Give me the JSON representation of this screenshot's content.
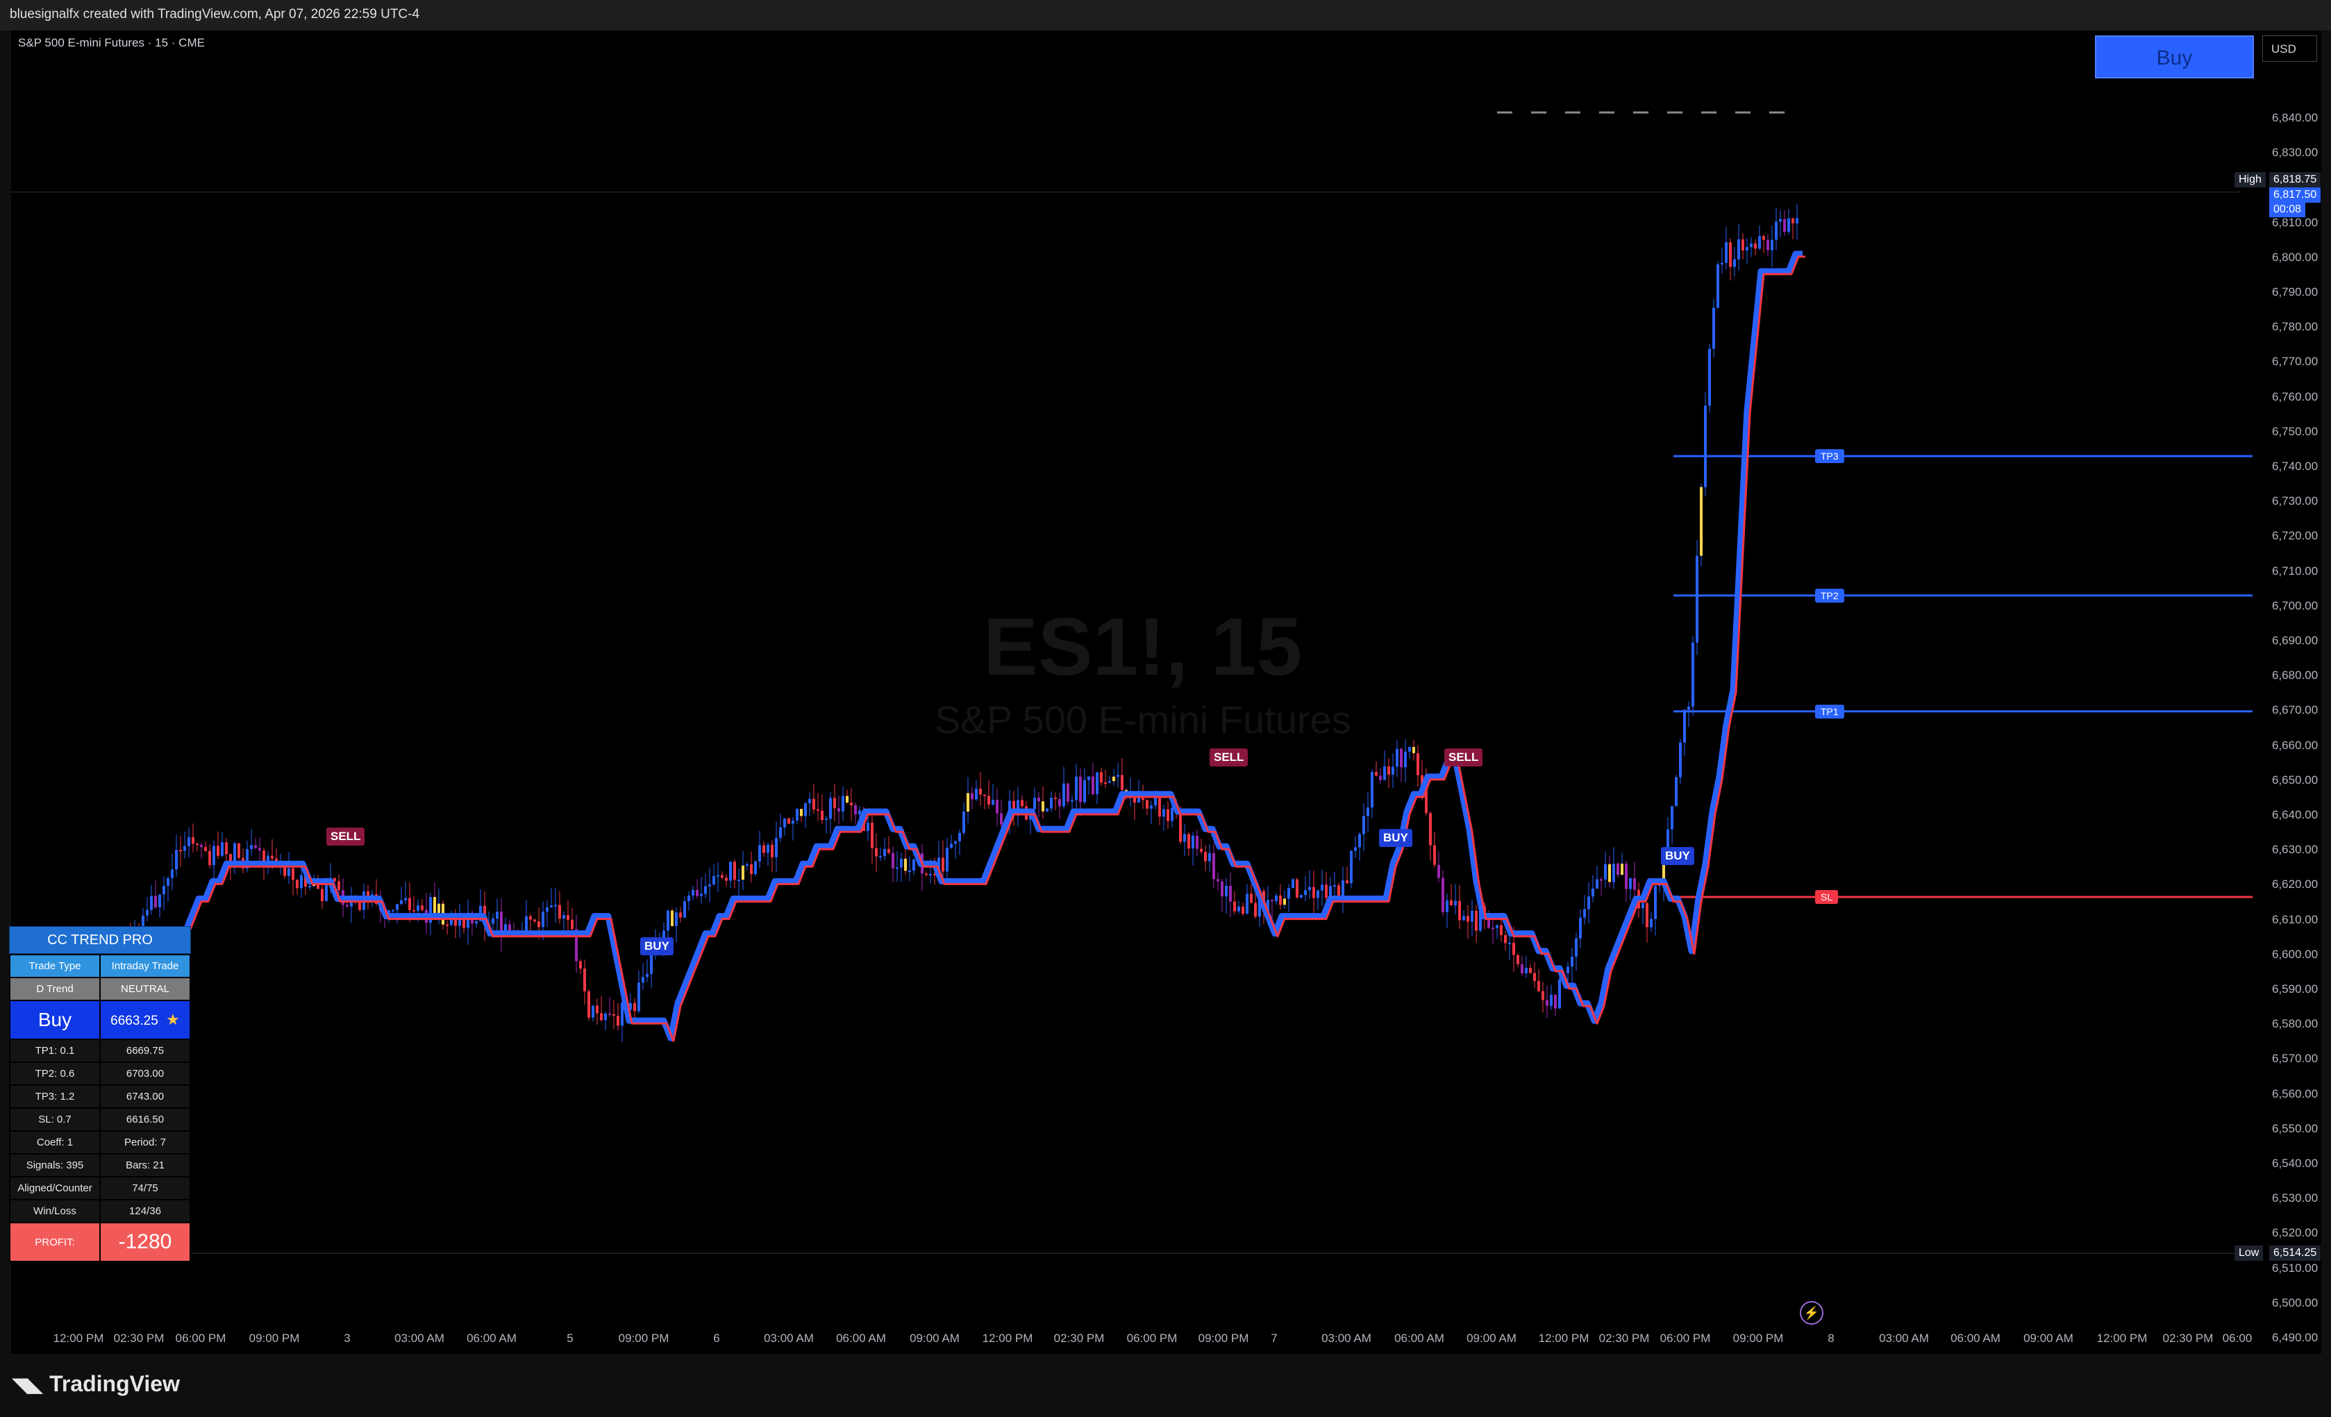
{
  "header": {
    "text": "bluesignalfx created with TradingView.com, Apr 07, 2026 22:59 UTC-4"
  },
  "symbol": {
    "title": "S&P 500 E-mini Futures · 15 · CME",
    "watermark_ticker": "ES1!, 15",
    "watermark_name": "S&P 500 E-mini Futures"
  },
  "trade": {
    "buy_label": "Buy",
    "currency": "USD"
  },
  "price_axis": {
    "ticks": [
      "6,840.00",
      "6,830.00",
      "6,810.00",
      "6,800.00",
      "6,790.00",
      "6,780.00",
      "6,770.00",
      "6,760.00",
      "6,750.00",
      "6,740.00",
      "6,730.00",
      "6,720.00",
      "6,710.00",
      "6,700.00",
      "6,690.00",
      "6,680.00",
      "6,670.00",
      "6,660.00",
      "6,650.00",
      "6,640.00",
      "6,630.00",
      "6,620.00",
      "6,610.00",
      "6,600.00",
      "6,590.00",
      "6,580.00",
      "6,570.00",
      "6,560.00",
      "6,550.00",
      "6,540.00",
      "6,530.00",
      "6,520.00",
      "6,510.00",
      "6,500.00",
      "6,490.00"
    ],
    "high_label": "High",
    "high_value": "6,818.75",
    "last_price": "6,817.50",
    "countdown": "00:08",
    "low_label": "Low",
    "low_value": "6,514.25",
    "colors": {
      "up": "#2962ff",
      "down": "#f23645",
      "accent": "#2962ff"
    }
  },
  "time_axis": {
    "labels": [
      "12:00 PM",
      "02:30 PM",
      "06:00 PM",
      "09:00 PM",
      "3",
      "03:00 AM",
      "06:00 AM",
      "5",
      "09:00 PM",
      "6",
      "03:00 AM",
      "06:00 AM",
      "09:00 AM",
      "12:00 PM",
      "02:30 PM",
      "06:00 PM",
      "09:00 PM",
      "7",
      "03:00 AM",
      "06:00 AM",
      "09:00 AM",
      "12:00 PM",
      "02:30 PM",
      "06:00 PM",
      "09:00 PM",
      "8",
      "03:00 AM",
      "06:00 AM",
      "09:00 AM",
      "12:00 PM",
      "02:30 PM",
      "06:00"
    ]
  },
  "signals": [
    {
      "label": "SELL",
      "type": "sell"
    },
    {
      "label": "BUY",
      "type": "buy"
    },
    {
      "label": "SELL",
      "type": "sell"
    },
    {
      "label": "BUY",
      "type": "buy"
    },
    {
      "label": "SELL",
      "type": "sell"
    },
    {
      "label": "BUY",
      "type": "buy"
    }
  ],
  "levels": [
    {
      "label": "TP3",
      "price": 6743.0
    },
    {
      "label": "TP2",
      "price": 6703.0
    },
    {
      "label": "TP1",
      "price": 6669.75
    },
    {
      "label": "SL",
      "price": 6616.5
    }
  ],
  "panel": {
    "title": "CC TREND PRO",
    "rows": [
      [
        "Trade Type",
        "Intraday Trade"
      ],
      [
        "D Trend",
        "NEUTRAL"
      ],
      [
        "Buy",
        "6663.25"
      ],
      [
        "TP1: 0.1",
        "6669.75"
      ],
      [
        "TP2: 0.6",
        "6703.00"
      ],
      [
        "TP3: 1.2",
        "6743.00"
      ],
      [
        "SL: 0.7",
        "6616.50"
      ],
      [
        "Coeff: 1",
        "Period: 7"
      ],
      [
        "Signals: 395",
        "Bars: 21"
      ],
      [
        "Aligned/Counter",
        "74/75"
      ],
      [
        "Win/Loss",
        "124/36"
      ],
      [
        "PROFIT:",
        "-1280"
      ]
    ],
    "star_icon": "star-icon"
  },
  "footer": {
    "brand": "TradingView",
    "logo_icon": "tradingview-logo-icon"
  }
}
